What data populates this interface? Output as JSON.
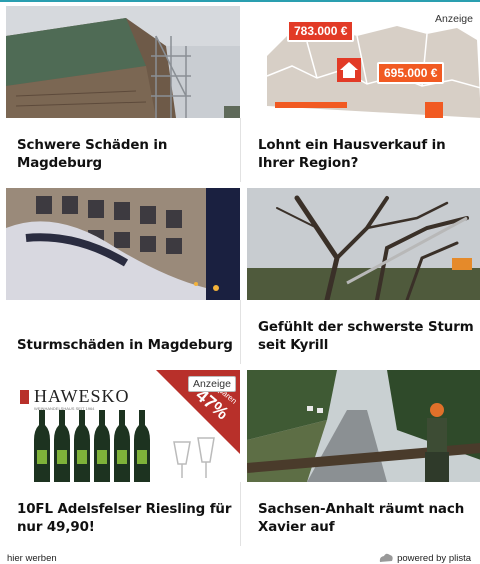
{
  "cards": [
    {
      "title": "Schwere Schäden in Magdeburg"
    },
    {
      "title": "Lohnt ein Hausverkauf in Ihrer Region?",
      "badge": "Anzeige",
      "price1": "783.000 €",
      "price2": "695.000 €"
    },
    {
      "title": "Sturmschäden in Magdeburg"
    },
    {
      "title": "Gefühlt der schwerste Sturm seit Kyrill"
    },
    {
      "title": "10FL Adelsfelser Riesling für nur 49,90!",
      "badge": "Anzeige",
      "brand": "HAWESKO",
      "brand_sub": "WEINHANDELSHAUS SEIT 1964",
      "ribbon_pct": "47%",
      "ribbon_sub": "sparen"
    },
    {
      "title": "Sachsen-Anhalt räumt nach Xavier auf"
    }
  ],
  "footer": {
    "left": "hier werben",
    "right": "powered by plista",
    "icon": "plista-logo-icon"
  },
  "colors": {
    "accent": "#2a9fb0",
    "price_red": "#e23a26",
    "price_orange": "#f15a22"
  }
}
